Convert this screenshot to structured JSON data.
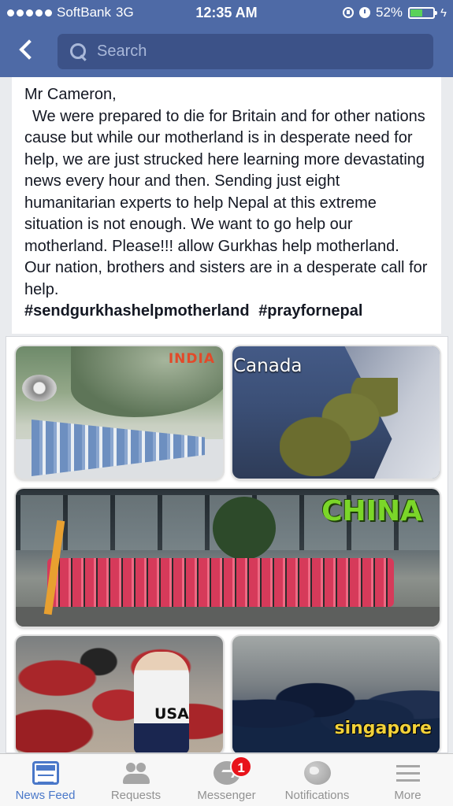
{
  "status_bar": {
    "carrier": "SoftBank",
    "network": "3G",
    "time": "12:35 AM",
    "battery": "52%",
    "battery_level": 0.52
  },
  "nav": {
    "search_placeholder": "Search"
  },
  "post": {
    "greeting": "Mr Cameron,",
    "body": "We were prepared to die for Britain and for other nations cause but while our motherland is in desperate need for help, we are just strucked here learning more  devastating news every hour and then. Sending just eight humanitarian experts to help Nepal at this extreme situation is not enough. We want to go help our motherland. Please!!! allow Gurkhas help motherland. Our nation, brothers and sisters are in a desperate call for help.",
    "hashtags": [
      "#sendgurkhashelpmotherland",
      "#prayfornepal"
    ]
  },
  "photos": {
    "india": "INDIA",
    "canada": "Canada",
    "china": "CHINA",
    "usa": "USA",
    "singapore": "singapore"
  },
  "tabs": [
    {
      "label": "News Feed",
      "icon": "news-feed-icon",
      "active": true
    },
    {
      "label": "Requests",
      "icon": "friend-requests-icon",
      "active": false
    },
    {
      "label": "Messenger",
      "icon": "messenger-icon",
      "active": false,
      "badge": "1"
    },
    {
      "label": "Notifications",
      "icon": "globe-icon",
      "active": false
    },
    {
      "label": "More",
      "icon": "menu-icon",
      "active": false
    }
  ],
  "colors": {
    "header_blue": "#4e6aa6",
    "search_bg": "#3c5288",
    "active_tab": "#4a78c9",
    "badge_red": "#e8131b",
    "battery_green": "#5ad25a"
  }
}
